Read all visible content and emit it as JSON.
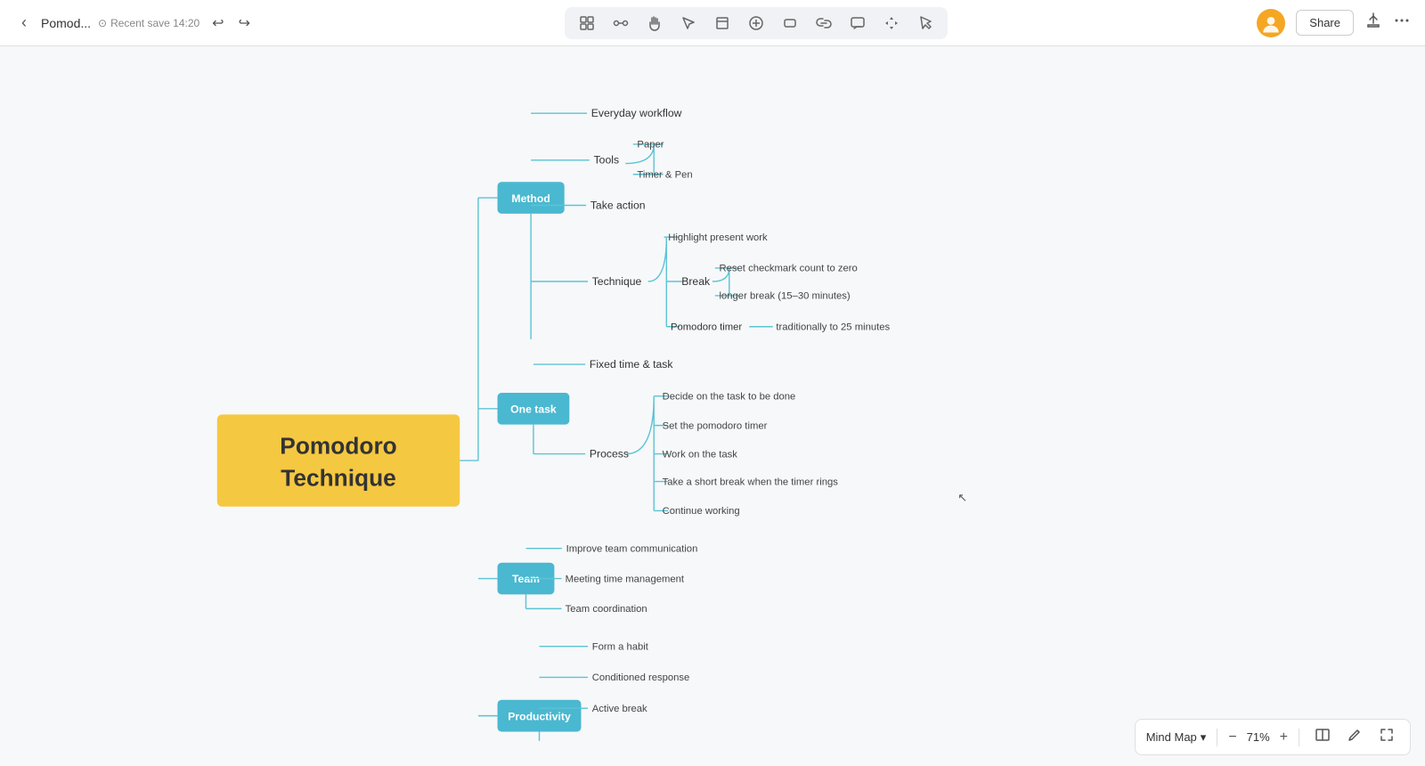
{
  "topbar": {
    "back_label": "‹",
    "title": "Pomod...",
    "save_info": "Recent save 14:20",
    "undo_label": "↩",
    "redo_label": "↪"
  },
  "toolbar": {
    "tools": [
      {
        "name": "select-tool",
        "icon": "⬡",
        "label": "Select"
      },
      {
        "name": "connect-tool",
        "icon": "⬡",
        "label": "Connect"
      },
      {
        "name": "hand-tool",
        "icon": "⬡",
        "label": "Hand"
      },
      {
        "name": "pointer-tool",
        "icon": "⬡",
        "label": "Pointer"
      },
      {
        "name": "frame-tool",
        "icon": "⬡",
        "label": "Frame"
      },
      {
        "name": "add-tool",
        "icon": "⊕",
        "label": "Add"
      },
      {
        "name": "shape-tool",
        "icon": "⬡",
        "label": "Shape"
      },
      {
        "name": "link-tool",
        "icon": "⬡",
        "label": "Link"
      },
      {
        "name": "comment-tool",
        "icon": "⬡",
        "label": "Comment"
      },
      {
        "name": "move-tool",
        "icon": "✛",
        "label": "Move"
      },
      {
        "name": "pointer2-tool",
        "icon": "⬡",
        "label": "Pointer2"
      }
    ]
  },
  "topbar_right": {
    "share_label": "Share",
    "export_label": "⬆",
    "more_label": "⋯"
  },
  "mindmap": {
    "root": {
      "label": "Pomodoro\nTechnique"
    },
    "branches": [
      {
        "id": "method",
        "label": "Method",
        "color": "#4ab8d0",
        "children": [
          {
            "label": "Everyday workflow",
            "children": []
          },
          {
            "label": "Tools",
            "children": [
              {
                "label": "Paper"
              },
              {
                "label": "Timer & Pen"
              }
            ]
          },
          {
            "label": "Take action",
            "children": []
          },
          {
            "label": "Technique",
            "children": [
              {
                "label": "Highlight present work",
                "children": []
              },
              {
                "label": "Break",
                "children": [
                  {
                    "label": "Reset checkmark count to zero"
                  },
                  {
                    "label": "longer break (15–30 minutes)"
                  }
                ]
              },
              {
                "label": "Pomodoro timer",
                "children": [
                  {
                    "label": "traditionally to 25 minutes"
                  }
                ]
              }
            ]
          }
        ]
      },
      {
        "id": "one-task",
        "label": "One task",
        "color": "#4ab8d0",
        "children": [
          {
            "label": "Fixed time & task",
            "children": []
          },
          {
            "label": "Process",
            "children": [
              {
                "label": "Decide on the task to be done"
              },
              {
                "label": "Set the pomodoro timer"
              },
              {
                "label": "Work on the task"
              },
              {
                "label": "Take a short break when the timer rings"
              },
              {
                "label": "Continue working"
              }
            ]
          }
        ]
      },
      {
        "id": "team",
        "label": "Team",
        "color": "#4ab8d0",
        "children": [
          {
            "label": "Improve team communication"
          },
          {
            "label": "Meeting time management"
          },
          {
            "label": "Team coordination"
          }
        ]
      },
      {
        "id": "productivity",
        "label": "Productivity",
        "color": "#4ab8d0",
        "children": [
          {
            "label": "Form a habit"
          },
          {
            "label": "Conditioned response"
          },
          {
            "label": "Active break"
          }
        ]
      }
    ]
  },
  "bottombar": {
    "mode_label": "Mind Map",
    "zoom_level": "71%",
    "zoom_in": "+",
    "zoom_out": "−"
  }
}
